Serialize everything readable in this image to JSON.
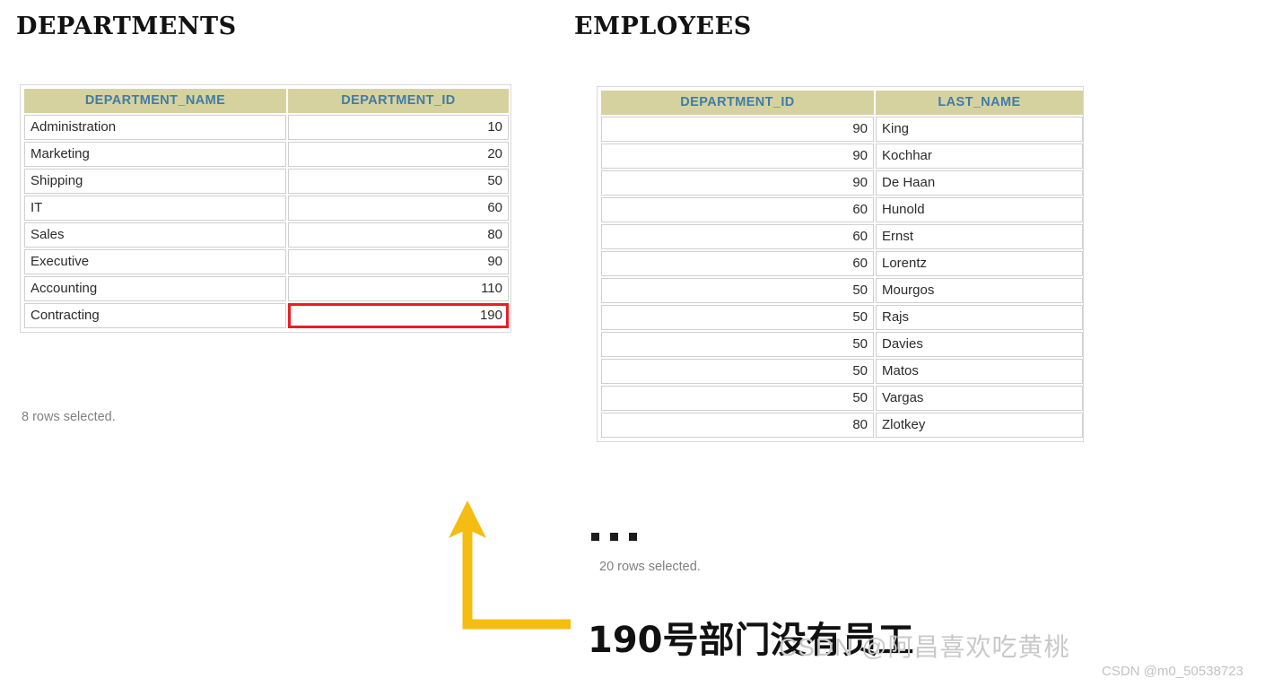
{
  "departments": {
    "title": "DEPARTMENTS",
    "columns": [
      "DEPARTMENT_NAME",
      "DEPARTMENT_ID"
    ],
    "rows": [
      {
        "name": "Administration",
        "id": "10",
        "highlight": false
      },
      {
        "name": "Marketing",
        "id": "20",
        "highlight": false
      },
      {
        "name": "Shipping",
        "id": "50",
        "highlight": false
      },
      {
        "name": "IT",
        "id": "60",
        "highlight": false
      },
      {
        "name": "Sales",
        "id": "80",
        "highlight": false
      },
      {
        "name": "Executive",
        "id": "90",
        "highlight": false
      },
      {
        "name": "Accounting",
        "id": "110",
        "highlight": false
      },
      {
        "name": "Contracting",
        "id": "190",
        "highlight": true
      }
    ],
    "caption": "8 rows selected."
  },
  "employees": {
    "title": "EMPLOYEES",
    "columns": [
      "DEPARTMENT_ID",
      "LAST_NAME"
    ],
    "rows": [
      {
        "dept_id": "90",
        "last_name": "King"
      },
      {
        "dept_id": "90",
        "last_name": "Kochhar"
      },
      {
        "dept_id": "90",
        "last_name": "De Haan"
      },
      {
        "dept_id": "60",
        "last_name": "Hunold"
      },
      {
        "dept_id": "60",
        "last_name": "Ernst"
      },
      {
        "dept_id": "60",
        "last_name": "Lorentz"
      },
      {
        "dept_id": "50",
        "last_name": "Mourgos"
      },
      {
        "dept_id": "50",
        "last_name": "Rajs"
      },
      {
        "dept_id": "50",
        "last_name": "Davies"
      },
      {
        "dept_id": "50",
        "last_name": "Matos"
      },
      {
        "dept_id": "50",
        "last_name": "Vargas"
      },
      {
        "dept_id": "80",
        "last_name": "Zlotkey"
      }
    ],
    "ellipsis": "...",
    "caption": "20 rows selected."
  },
  "annotation": {
    "text": "190号部门没有员工",
    "arrow_color": "#f5bc12"
  },
  "watermarks": {
    "center": "CSDN @阿昌喜欢吃黄桃",
    "corner": "CSDN @m0_50538723"
  },
  "colors": {
    "header_bg": "#d6d2a0",
    "header_text": "#3f7ca6",
    "highlight_border": "#ed1c24",
    "arrow": "#f5bc12",
    "grid_border": "#cfcfcf"
  }
}
